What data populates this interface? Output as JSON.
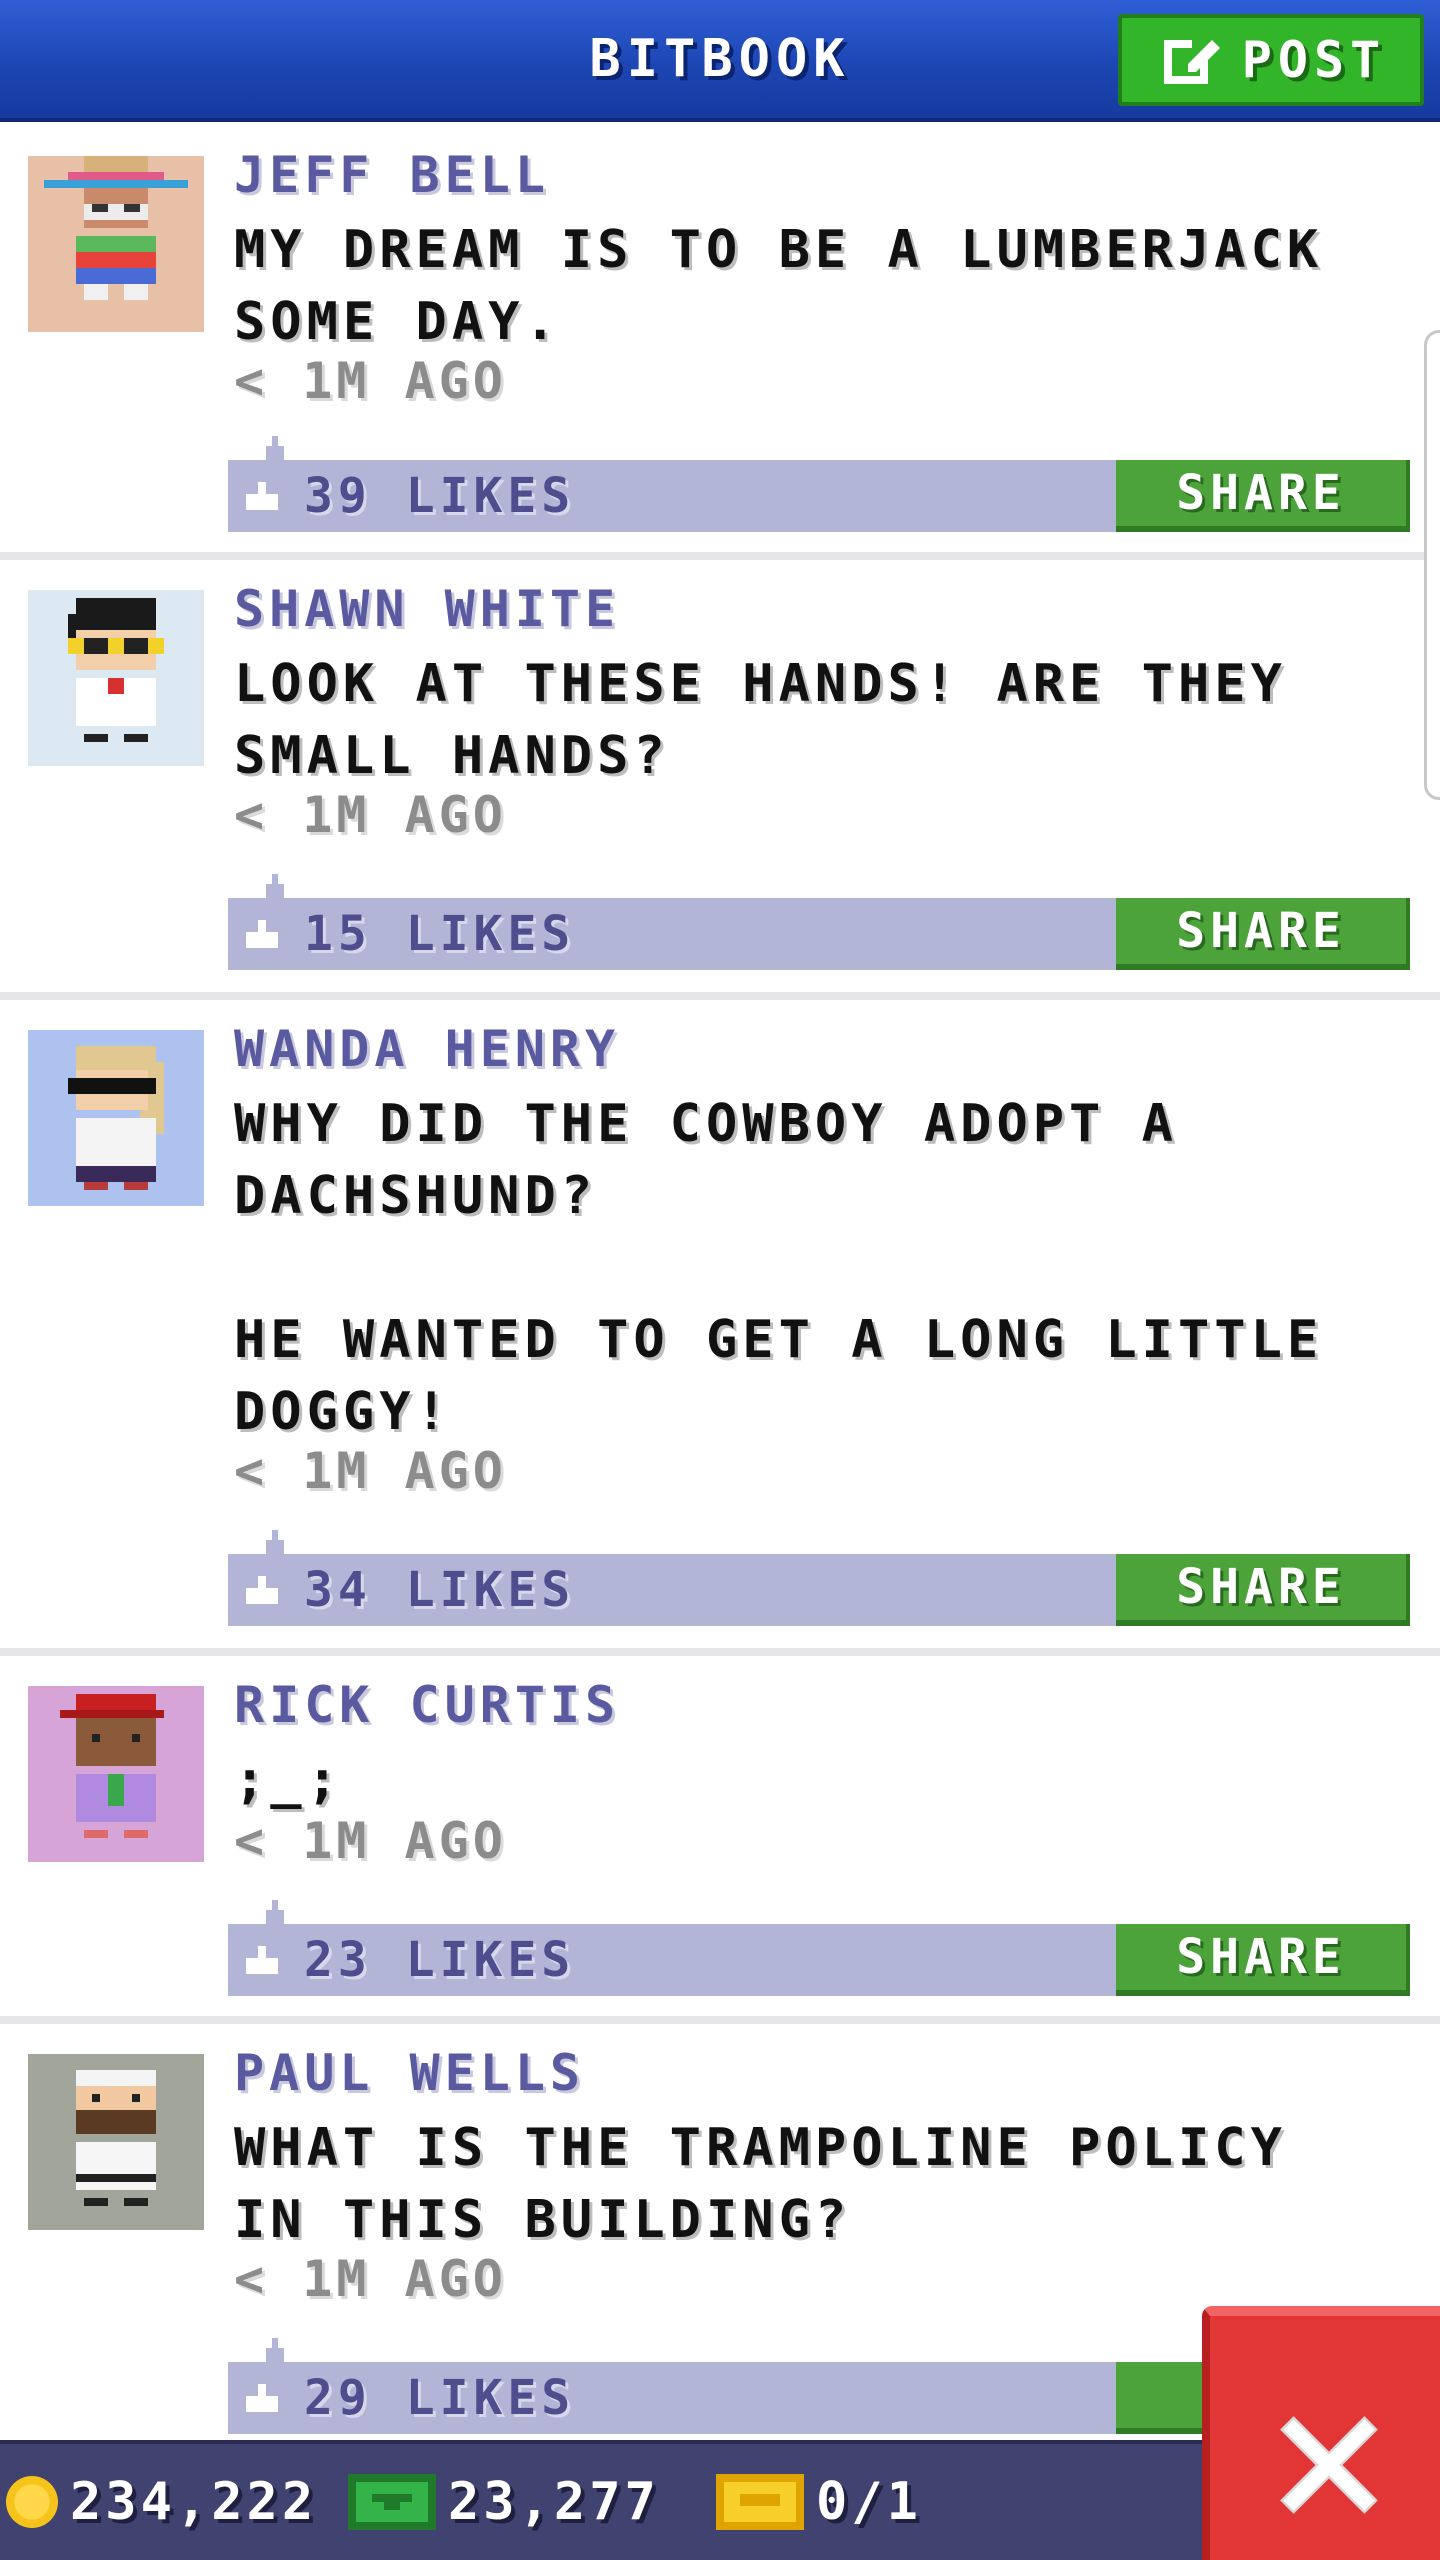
{
  "header": {
    "title": "BITBOOK",
    "post_label": "POST"
  },
  "posts": [
    {
      "author": "JEFF BELL",
      "message": "MY DREAM IS TO BE A LUMBERJACK SOME DAY.",
      "time": "< 1M AGO",
      "likes": "39 LIKES",
      "share_label": "SHARE",
      "avatar_bg": "#e8c0a8"
    },
    {
      "author": "SHAWN WHITE",
      "message": "LOOK AT THESE HANDS! ARE THEY SMALL HANDS?",
      "time": "< 1M AGO",
      "likes": "15 LIKES",
      "share_label": "SHARE",
      "avatar_bg": "#dde9f2"
    },
    {
      "author": "WANDA HENRY",
      "message": "WHY DID THE COWBOY ADOPT A DACHSHUND?\n\nHE WANTED TO GET A LONG LITTLE DOGGY!",
      "time": "< 1M AGO",
      "likes": "34 LIKES",
      "share_label": "SHARE",
      "avatar_bg": "#aec2f0"
    },
    {
      "author": "RICK CURTIS",
      "message": ";_;",
      "time": "< 1M AGO",
      "likes": "23 LIKES",
      "share_label": "SHARE",
      "avatar_bg": "#d6a4d6"
    },
    {
      "author": "PAUL WELLS",
      "message": "WHAT IS THE TRAMPOLINE POLICY IN THIS BUILDING?",
      "time": "< 1M AGO",
      "likes": "29 LIKES",
      "share_label": "S",
      "avatar_bg": "#a2a69a"
    }
  ],
  "status": {
    "coins": "234,222",
    "bux": "23,277",
    "tickets": "0/1"
  },
  "colors": {
    "header_blue": "#1d46b4",
    "post_green": "#33b52a",
    "share_green": "#4ca33a",
    "likes_bar": "#b3b5d6",
    "author_purple": "#5a5aa0",
    "status_bar": "#404270",
    "close_red": "#e23636"
  },
  "icons": {
    "post": "edit-icon",
    "like": "thumbs-up-icon",
    "coins": "coin-icon",
    "bux": "cash-icon",
    "tickets": "ticket-icon",
    "close": "close-icon"
  }
}
